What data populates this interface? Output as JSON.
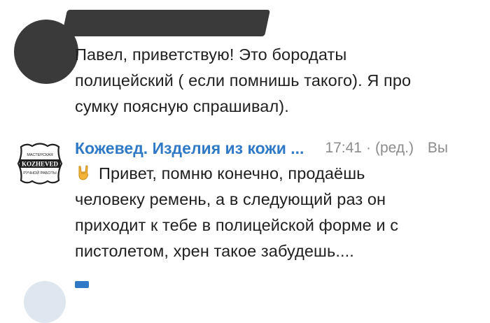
{
  "message1": {
    "lines": [
      "Павел, приветствую! Это бородаты",
      "полицейский ( если помнишь такого). Я про",
      "сумку поясную спрашивал)."
    ]
  },
  "message2": {
    "sender": "Кожевед. Изделия из кожи ...",
    "time": "17:41",
    "separator": "·",
    "edited": "(ред.)",
    "extra": "Вы",
    "logo_text": [
      "МАСТЕРСКАЯ",
      "KOZHEVED",
      "РУЧНОЙ РАБОТЫ"
    ],
    "emoji_icon": "rock-on-hand-icon",
    "lines": [
      "Привет, помню конечно, продаёшь",
      "человеку ремень, а в следующий раз он",
      "приходит к тебе в полицейской форме и с",
      "пистолетом, хрен такое забудешь...."
    ]
  },
  "colors": {
    "accent": "#2f79c7",
    "meta": "#8b8b8b",
    "text": "#1f1f1f",
    "redaction": "#3a3a3a"
  }
}
